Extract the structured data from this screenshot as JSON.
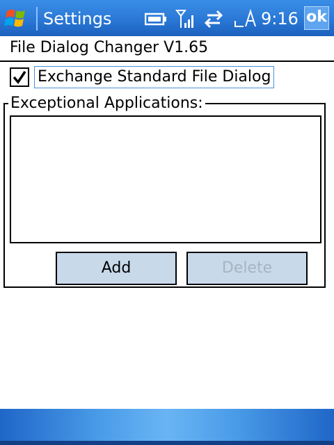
{
  "statusbar": {
    "title": "Settings",
    "time": "9:16",
    "ok_label": "ok",
    "icons": [
      "windows-start-icon",
      "battery-icon",
      "signal-icon",
      "sync-icon",
      "input-mode-icon"
    ]
  },
  "app": {
    "header": "File Dialog Changer V1.65",
    "exchange_checkbox": {
      "label": "Exchange Standard File Dialog",
      "checked": true
    },
    "group": {
      "title": "Exceptional Applications:",
      "items": []
    },
    "buttons": {
      "add": "Add",
      "delete": "Delete"
    }
  },
  "colors": {
    "titlebar": "#2a78d6",
    "button_face": "#c8d9ea",
    "disabled_text": "#a8b4c0",
    "focus_border": "#4a90d9"
  }
}
